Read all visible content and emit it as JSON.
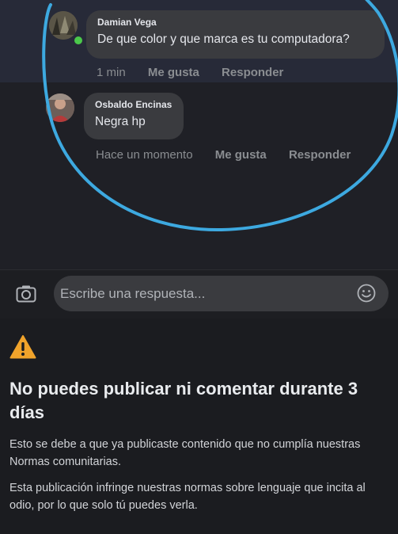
{
  "comments": [
    {
      "author": "Damian Vega",
      "text": "De que color y que marca es tu computadora?",
      "time": "1 min",
      "like_label": "Me gusta",
      "reply_label": "Responder"
    },
    {
      "author": "Osbaldo Encinas",
      "text": "Negra hp",
      "time": "Hace un momento",
      "like_label": "Me gusta",
      "reply_label": "Responder"
    }
  ],
  "reply_box": {
    "placeholder": "Escribe una respuesta..."
  },
  "notice": {
    "title": "No puedes publicar ni comentar durante 3 días",
    "paragraph1": "Esto se debe a que ya publicaste contenido que no cumplía nuestras Normas comunitarias.",
    "paragraph2": "Esta publicación infringe nuestras normas sobre lenguaje que incita al odio, por lo que solo tú puedes verla."
  },
  "colors": {
    "annotation_circle": "#3da9e0",
    "warning": "#f0a32b",
    "online": "#4bc94b"
  },
  "icons": [
    "camera-icon",
    "emoji-icon",
    "warning-icon"
  ]
}
